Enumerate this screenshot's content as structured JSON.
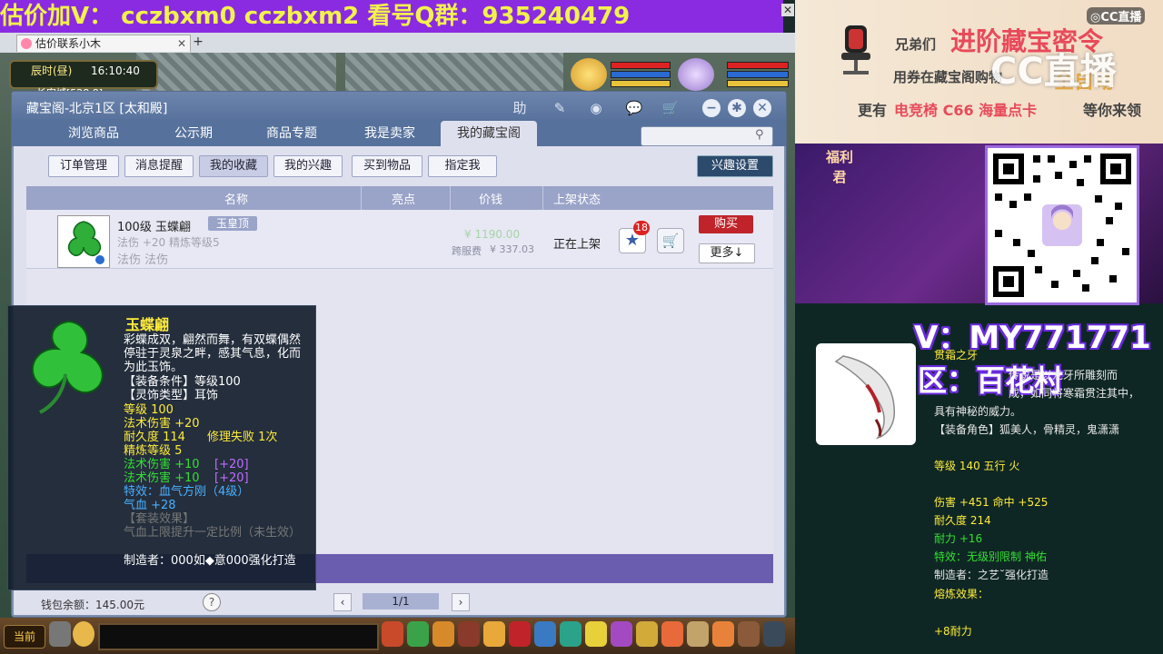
{
  "banner": {
    "text": "估价加V：  cczbxm0   cczbxm2   看号Q群：935240479"
  },
  "browser": {
    "tab_title": "估价联系小木",
    "tab_close": "✕",
    "tab_add": "+"
  },
  "hud_top": {
    "time_label": "辰时(昼)",
    "time_value": "16:10:40",
    "location": "长安城[528,8]"
  },
  "window": {
    "title": "藏宝阁-北京1区 [太和殿]",
    "toolbar": {
      "help": "助",
      "minimize": "−",
      "settings": "✱",
      "close": "✕"
    },
    "nav_tabs": [
      "浏览商品",
      "公示期",
      "商品专题",
      "我是卖家",
      "我的藏宝阁"
    ],
    "active_nav": "我的藏宝阁",
    "sub_tabs": [
      "订单管理",
      "消息提醒",
      "我的收藏",
      "我的兴趣",
      "买到物品",
      "指定我"
    ],
    "active_sub": "我的收藏",
    "interest_settings": "兴趣设置",
    "table_headers": {
      "name": "名称",
      "highlights": "亮点",
      "price": "价钱",
      "status": "上架状态"
    },
    "row": {
      "item_name": "100级  玉蝶翩",
      "badge": "玉皇顶",
      "attr_line1": "法伤 +20  精炼等级5",
      "attr_line2": "法伤  法伤",
      "price": "¥ 1190.00",
      "cross_label": "跨服费",
      "cross_price": "¥ 337.03",
      "status": "正在上架",
      "fav_count": "18",
      "buy": "购买",
      "more": "更多↓"
    },
    "footer": {
      "balance": "钱包余额：145.00元",
      "help": "?",
      "prev": "‹",
      "page": "1/1",
      "next": "›"
    }
  },
  "tooltip": {
    "title": "玉蝶翩",
    "desc": "彩蝶成双，翩然而舞，有双蝶偶然停驻于灵泉之畔，感其气息，化而为此玉饰。",
    "req_level": "【装备条件】等级100",
    "type": "【灵饰类型】耳饰",
    "level": "等级 100",
    "magic_dmg": "法术伤害 +20",
    "durability": "耐久度 114",
    "repair": "修理失败 1次",
    "refine": "精炼等级 5",
    "extra1": "法术伤害 +10",
    "extra1_b": "[+20]",
    "extra2": "法术伤害 +10",
    "extra2_b": "[+20]",
    "special": "特效：血气方刚（4级）",
    "hp": "气血 +28",
    "set_label": "【套装效果】",
    "set_desc": "气血上限提升一定比例（未生效）",
    "maker": "制造者：000如◆意000强化打造"
  },
  "right_panel": {
    "ad_line1_a": "兄弟们",
    "ad_line1_b": "进阶藏宝密令",
    "ad_line2_a": "用券在藏宝阁购物",
    "ad_line2_b": "全自动",
    "ad_line3_a": "更有",
    "ad_line3_b": "电竞椅 C66 海量点卡",
    "ad_line3_c": "等你来领",
    "cc_logo": "◎CC直播",
    "cc_watermark": "CC直播",
    "welfare": "福利君",
    "v_text": "V：MY771771",
    "zone_text": "区：百花村",
    "card": {
      "title": "贯霜之牙",
      "desc1": "传说是以龙牙所雕刻而",
      "desc2": "成，如同将寒霜贯注其中，",
      "desc3": "具有神秘的威力。",
      "roles": "【装备角色】狐美人，骨精灵，鬼潇潇",
      "level": "等级 140 五行 火",
      "damage": "伤害 +451 命中 +525",
      "durability": "耐久度 214",
      "stamina": "耐力 +16",
      "special": "特效：无级别限制 神佑",
      "maker": "制造者：之艺˘强化打造",
      "melt": "熔炼效果：",
      "melt_val": "+8耐力"
    }
  },
  "hud_bottom": {
    "now": "当前"
  },
  "colors": {
    "banner_bg": "#8a2be2",
    "banner_text": "#f2f24a",
    "title_bar": "#56719c",
    "buy_red": "#c0232a",
    "tooltip_yellow": "#ffec3a",
    "tooltip_green": "#33e033"
  }
}
